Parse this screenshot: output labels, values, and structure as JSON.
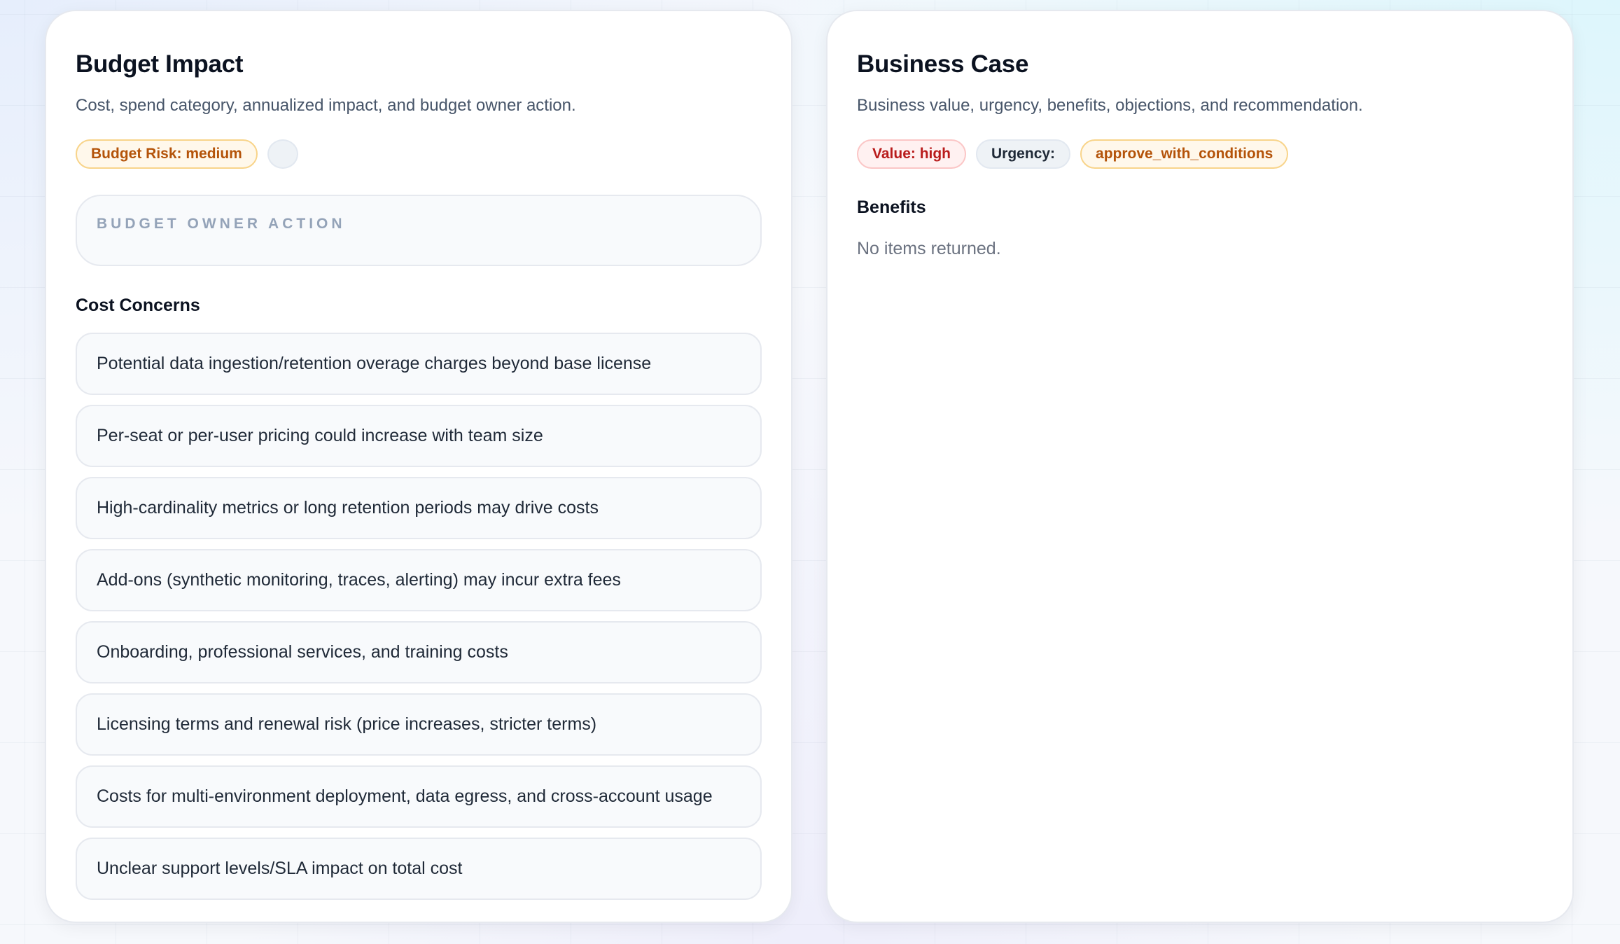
{
  "budget_impact": {
    "title": "Budget Impact",
    "subtitle": "Cost, spend category, annualized impact, and budget owner action.",
    "badges": {
      "budget_risk": "Budget Risk: medium",
      "empty": ""
    },
    "owner_action": {
      "label": "BUDGET OWNER ACTION",
      "value": ""
    },
    "cost_concerns": {
      "heading": "Cost Concerns",
      "items": [
        "Potential data ingestion/retention overage charges beyond base license",
        "Per-seat or per-user pricing could increase with team size",
        "High-cardinality metrics or long retention periods may drive costs",
        "Add-ons (synthetic monitoring, traces, alerting) may incur extra fees",
        "Onboarding, professional services, and training costs",
        "Licensing terms and renewal risk (price increases, stricter terms)",
        "Costs for multi-environment deployment, data egress, and cross-account usage",
        "Unclear support levels/SLA impact on total cost"
      ]
    }
  },
  "business_case": {
    "title": "Business Case",
    "subtitle": "Business value, urgency, benefits, objections, and recommendation.",
    "badges": {
      "value": "Value: high",
      "urgency": "Urgency:",
      "recommendation": "approve_with_conditions"
    },
    "benefits": {
      "heading": "Benefits",
      "empty_text": "No items returned."
    }
  },
  "colors": {
    "amber_text": "#b45309",
    "amber_border": "#f8d48a",
    "red_text": "#b91c1c",
    "red_border": "#fbc6c6",
    "muted_label": "#94a3b8"
  }
}
